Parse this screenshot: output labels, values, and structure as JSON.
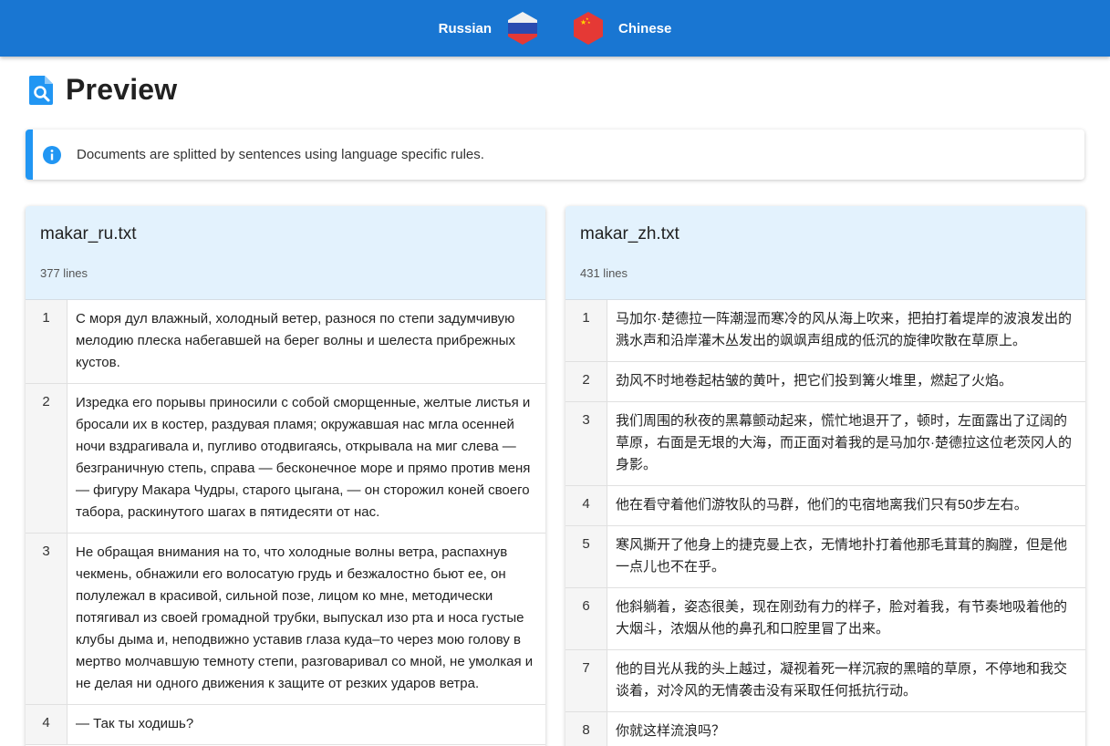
{
  "topbar": {
    "source_lang": "Russian",
    "target_lang": "Chinese",
    "source_flag_icon": "russia-flag-icon",
    "target_flag_icon": "china-flag-icon",
    "background": "#1976d2"
  },
  "header": {
    "title": "Preview",
    "icon": "file-search-icon"
  },
  "alert": {
    "icon": "info-icon",
    "text": "Documents are splitted by sentences using language specific rules.",
    "accent": "#2196f3"
  },
  "left_doc": {
    "filename": "makar_ru.txt",
    "line_count": "377 lines",
    "rows": [
      {
        "n": "1",
        "text": "С моря дул влажный, холодный ветер, разнося по степи задумчивую мелодию плеска набегавшей на берег волны и шелеста прибрежных кустов."
      },
      {
        "n": "2",
        "text": "Изредка его порывы приносили с собой сморщенные, желтые листья и бросали их в костер, раздувая пламя; окружавшая нас мгла осенней ночи вздрагивала и, пугливо отодвигаясь, открывала на миг слева — безграничную степь, справа — бесконечное море и прямо против меня — фигуру Макара Чудры, старого цыгана, — он сторожил коней своего табора, раскинутого шагах в пятидесяти от нас."
      },
      {
        "n": "3",
        "text": "Не обращая внимания на то, что холодные волны ветра, распахнув чекмень, обнажили его волосатую грудь и безжалостно бьют ее, он полулежал в красивой, сильной позе, лицом ко мне, методически потягивал из своей громадной трубки, выпускал изо рта и носа густые клубы дыма и, неподвижно уставив глаза куда–то через мою голову в мертво молчавшую темноту степи, разговаривал со мной, не умолкая и не делая ни одного движения к защите от резких ударов ветра."
      },
      {
        "n": "4",
        "text": "— Так ты ходишь?"
      }
    ]
  },
  "right_doc": {
    "filename": "makar_zh.txt",
    "line_count": "431 lines",
    "rows": [
      {
        "n": "1",
        "text": "马加尔·楚德拉一阵潮湿而寒冷的风从海上吹来，把拍打着堤岸的波浪发出的溅水声和沿岸灌木丛发出的飒飒声组成的低沉的旋律吹散在草原上。"
      },
      {
        "n": "2",
        "text": "劲风不时地卷起枯皱的黄叶，把它们投到篝火堆里，燃起了火焰。"
      },
      {
        "n": "3",
        "text": "我们周围的秋夜的黑幕颤动起来，慌忙地退开了，顿时，左面露出了辽阔的草原，右面是无垠的大海，而正面对着我的是马加尔·楚德拉这位老茨冈人的身影。"
      },
      {
        "n": "4",
        "text": "他在看守着他们游牧队的马群，他们的屯宿地离我们只有50步左右。"
      },
      {
        "n": "5",
        "text": "寒风撕开了他身上的捷克曼上衣，无情地扑打着他那毛茸茸的胸膛，但是他一点儿也不在乎。"
      },
      {
        "n": "6",
        "text": "他斜躺着，姿态很美，现在刚劲有力的样子，脸对着我，有节奏地吸着他的大烟斗，浓烟从他的鼻孔和口腔里冒了出来。"
      },
      {
        "n": "7",
        "text": "他的目光从我的头上越过，凝视着死一样沉寂的黑暗的草原，不停地和我交谈着，对冷风的无情袭击没有采取任何抵抗行动。"
      },
      {
        "n": "8",
        "text": "你就这样流浪吗？"
      }
    ]
  }
}
